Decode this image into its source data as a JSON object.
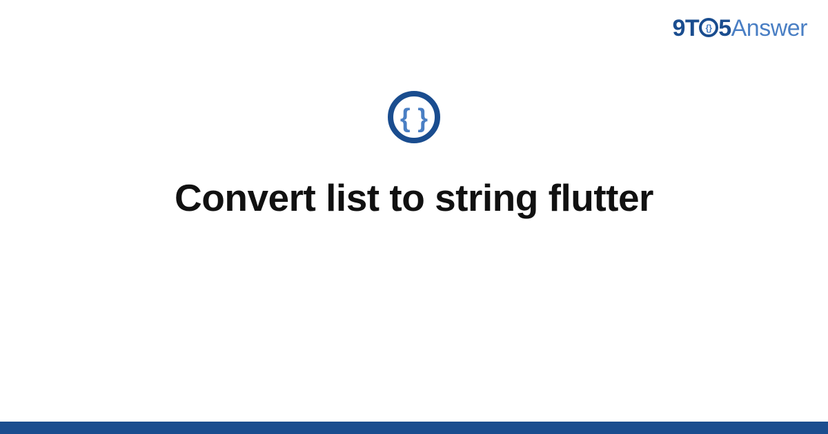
{
  "brand": {
    "nine": "9",
    "t": "T",
    "five": "5",
    "answer": "Answer"
  },
  "title": "Convert list to string flutter",
  "icon": {
    "name": "braces-icon",
    "ring_color": "#1a4d8f",
    "brace_color": "#4a7fc4"
  },
  "colors": {
    "brand_dark": "#1a4d8f",
    "brand_light": "#4a7fc4",
    "bottom_bar": "#1a4d8f"
  }
}
